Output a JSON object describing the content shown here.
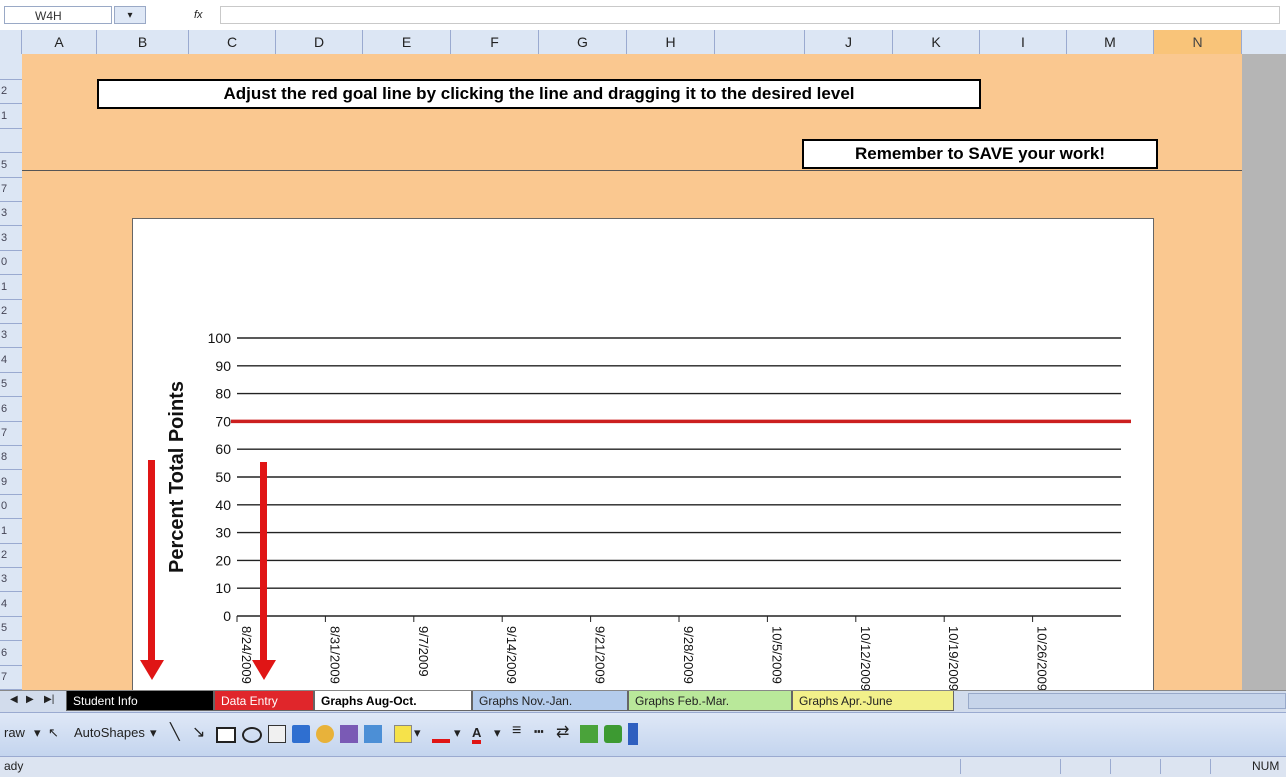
{
  "formula_bar": {
    "name_box_value": "W4H",
    "name_dropdown_icon": "chevron-down-icon",
    "fx_label": "fx"
  },
  "columns": [
    "A",
    "B",
    "C",
    "D",
    "E",
    "F",
    "G",
    "H",
    "",
    "J",
    "K",
    "I",
    "M",
    "N"
  ],
  "rows": [
    "",
    "2",
    "1",
    "",
    "5",
    "7",
    "3",
    "3",
    "0",
    "1",
    "2",
    "3",
    "4",
    "5",
    "6",
    "7",
    "8",
    "9",
    "0",
    "1",
    "2",
    "3",
    "4",
    "5",
    "6",
    "7"
  ],
  "instructions": {
    "goal_line": "Adjust the red goal line by clicking the line and dragging it to the desired level",
    "save_reminder": "Remember to SAVE your work!"
  },
  "chart_data": {
    "type": "line",
    "title": "",
    "ylabel": "Percent Total Points",
    "xlabel": "",
    "ylim": [
      0,
      100
    ],
    "yticks": [
      0,
      10,
      20,
      30,
      40,
      50,
      60,
      70,
      80,
      90,
      100
    ],
    "categories": [
      "8/24/2009",
      "8/31/2009",
      "9/7/2009",
      "9/14/2009",
      "9/21/2009",
      "9/28/2009",
      "10/5/2009",
      "10/12/2009",
      "10/19/2009",
      "10/26/2009"
    ],
    "series": [
      {
        "name": "",
        "color": "#cc1f1f",
        "values": [
          70,
          70,
          70,
          70,
          70,
          70,
          70,
          70,
          70,
          70
        ]
      }
    ],
    "grid": true,
    "legend": "none",
    "goal_line_value": 70
  },
  "sheet_tabs": [
    {
      "label": "Student Info",
      "bg": "#000000",
      "fg": "#ffffff"
    },
    {
      "label": "Data Entry",
      "bg": "#e0262b",
      "fg": "#ffffff"
    },
    {
      "label": "Graphs Aug-Oct.",
      "bg": "#ffffff",
      "fg": "#000000",
      "active": true
    },
    {
      "label": "Graphs Nov.-Jan.",
      "bg": "#b4ccec",
      "fg": "#222222"
    },
    {
      "label": "Graphs Feb.-Mar.",
      "bg": "#b9e89a",
      "fg": "#222222"
    },
    {
      "label": "Graphs Apr.-June",
      "bg": "#f2f08a",
      "fg": "#222222"
    }
  ],
  "draw_toolbar": {
    "draw_label": "raw",
    "autoshapes_label": "AutoShapes"
  },
  "status_bar": {
    "left_text": "ady",
    "right_text": "NUM"
  },
  "colors": {
    "sheet_background": "#fac890",
    "goal_line": "#cc1f1f",
    "arrow": "#e01515",
    "selected_column": "#f9c479"
  }
}
